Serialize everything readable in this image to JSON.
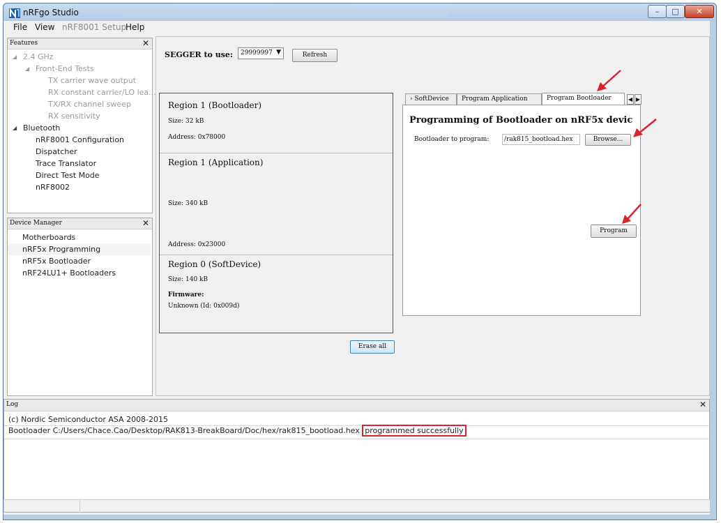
{
  "window": {
    "title": "nRFgo Studio",
    "controls": {
      "minimize": "–",
      "maximize": "□",
      "close": "✕"
    }
  },
  "menu": {
    "items": [
      {
        "label": "File",
        "enabled": true
      },
      {
        "label": "View",
        "enabled": true
      },
      {
        "label": "nRF8001 Setup",
        "enabled": false
      },
      {
        "label": "Help",
        "enabled": true
      }
    ]
  },
  "features": {
    "title": "Features",
    "close": "✕",
    "nodes": [
      {
        "label": "2.4 GHz",
        "state": "disabled"
      },
      {
        "label": "Front-End Tests",
        "state": "disabled"
      },
      {
        "label": "TX carrier wave output",
        "state": "disabled"
      },
      {
        "label": "RX constant carrier/LO lea...",
        "state": "disabled"
      },
      {
        "label": "TX/RX channel sweep",
        "state": "disabled"
      },
      {
        "label": "RX sensitivity",
        "state": "disabled"
      },
      {
        "label": "Bluetooth",
        "state": "enabled"
      },
      {
        "label": "nRF8001 Configuration",
        "state": "enabled"
      },
      {
        "label": "Dispatcher",
        "state": "enabled"
      },
      {
        "label": "Trace Translator",
        "state": "enabled"
      },
      {
        "label": "Direct Test Mode",
        "state": "enabled"
      },
      {
        "label": "nRF8002",
        "state": "enabled"
      }
    ]
  },
  "device_manager": {
    "title": "Device Manager",
    "close": "✕",
    "items": [
      {
        "label": "Motherboards",
        "selected": false
      },
      {
        "label": "nRF5x Programming",
        "selected": true
      },
      {
        "label": "nRF5x Bootloader",
        "selected": false
      },
      {
        "label": "nRF24LU1+ Bootloaders",
        "selected": false
      }
    ]
  },
  "segger": {
    "label": "SEGGER to use:",
    "selected": "29999997",
    "refresh_label": "Refresh"
  },
  "regions": [
    {
      "title": "Region 1 (Bootloader)",
      "size": "Size: 32 kB",
      "address": "Address: 0x78000"
    },
    {
      "title": "Region 1 (Application)",
      "size": "Size: 340 kB",
      "address": "Address:  0x23000"
    },
    {
      "title": "Region 0 (SoftDevice)",
      "size": "Size: 140 kB",
      "firmware_label": "Firmware:",
      "firmware_value": "Unknown (Id: 0x009d)"
    }
  ],
  "erase_all_label": "Erase all",
  "tabs": {
    "items": [
      {
        "label": "› SoftDevice",
        "active": false
      },
      {
        "label": "Program Application",
        "active": false
      },
      {
        "label": "Program Bootloader",
        "active": true
      }
    ],
    "scroll_left": "◀",
    "scroll_right": "▶"
  },
  "program_bootloader": {
    "heading": "Programming of Bootloader on nRF5x devic",
    "file_label": "Bootloader to program:",
    "file_value": "/rak815_bootload.hex",
    "browse_label": "Browse...",
    "program_label": "Program"
  },
  "log": {
    "title": "Log",
    "close": "✕",
    "lines": [
      {
        "text": "(c) Nordic Semiconductor ASA 2008-2015"
      },
      {
        "text": "Bootloader C:/Users/Chace.Cao/Desktop/RAK813-BreakBoard/Doc/hex/rak815_bootload.hex ",
        "highlight": "programmed successfully"
      }
    ]
  },
  "annotation_color": "#d9232e"
}
